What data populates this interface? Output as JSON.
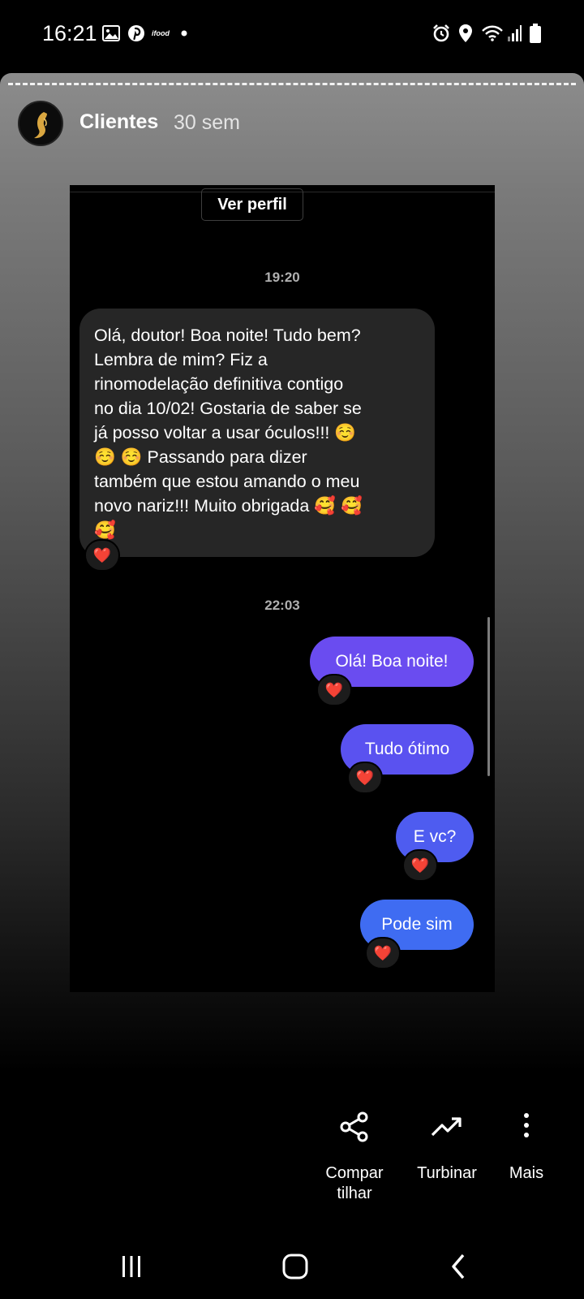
{
  "status_bar": {
    "time": "16:21",
    "left_icons": [
      "image-icon",
      "pinterest-icon",
      "ifood-icon",
      "dot-icon"
    ],
    "ifood_text": "ifood",
    "right_icons": [
      "alarm-icon",
      "location-icon",
      "wifi-icon",
      "signal-icon",
      "battery-icon"
    ]
  },
  "story": {
    "username": "Clientes",
    "time_ago": "30 sem"
  },
  "chat": {
    "profile_button": "Ver perfil",
    "timestamps": [
      "19:20",
      "22:03"
    ],
    "incoming_message": {
      "lines": [
        "Olá, doutor! Boa noite! Tudo bem?",
        "Lembra de mim? Fiz a",
        "rinomodelação definitiva contigo",
        "no dia 10/02! Gostaria de saber se",
        "já posso voltar a usar óculos!!! ☺️",
        "☺️ ☺️ Passando para dizer",
        "também que estou amando o meu",
        "novo nariz!!! Muito obrigada 🥰 🥰",
        "🥰"
      ],
      "reaction": "❤️"
    },
    "outgoing_messages": [
      {
        "text": "Olá! Boa noite!",
        "reaction": "❤️",
        "color": "#6a4cf0"
      },
      {
        "text": "Tudo ótimo",
        "reaction": "❤️",
        "color": "#5a52f0"
      },
      {
        "text": "E vc?",
        "reaction": "❤️",
        "color": "#4e5cf0"
      },
      {
        "text": "Pode sim",
        "reaction": "❤️",
        "color": "#3f6cf2"
      }
    ]
  },
  "actions": [
    {
      "icon": "share-icon",
      "label_line1": "Compar",
      "label_line2": "tilhar"
    },
    {
      "icon": "trending-up-icon",
      "label": "Turbinar"
    },
    {
      "icon": "more-vertical-icon",
      "label": "Mais"
    }
  ],
  "nav": [
    "recents-icon",
    "home-icon",
    "back-icon"
  ]
}
